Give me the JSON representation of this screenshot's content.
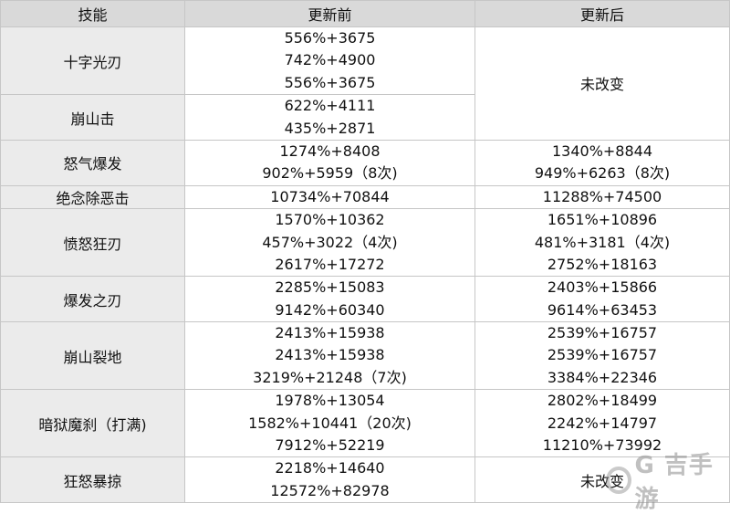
{
  "headers": {
    "skill": "技能",
    "before": "更新前",
    "after": "更新后"
  },
  "rows": [
    {
      "skill": "十字光刃",
      "before": [
        "556%+3675",
        "742%+4900",
        "556%+3675"
      ]
    },
    {
      "skill": "崩山击",
      "before": [
        "622%+4111",
        "435%+2871"
      ]
    },
    {
      "skill": "怒气爆发",
      "before": [
        "1274%+8408",
        "902%+5959（8次)"
      ],
      "after": [
        "1340%+8844",
        "949%+6263（8次)"
      ]
    },
    {
      "skill": "绝念除恶击",
      "before": [
        "10734%+70844"
      ],
      "after": [
        "11288%+74500"
      ]
    },
    {
      "skill": "愤怒狂刃",
      "before": [
        "1570%+10362",
        "457%+3022（4次)",
        "2617%+17272"
      ],
      "after": [
        "1651%+10896",
        "481%+3181（4次)",
        "2752%+18163"
      ]
    },
    {
      "skill": "爆发之刃",
      "before": [
        "2285%+15083",
        "9142%+60340"
      ],
      "after": [
        "2403%+15866",
        "9614%+63453"
      ]
    },
    {
      "skill": "崩山裂地",
      "before": [
        "2413%+15938",
        "2413%+15938",
        "3219%+21248（7次)"
      ],
      "after": [
        "2539%+16757",
        "2539%+16757",
        "3384%+22346"
      ]
    },
    {
      "skill": "暗狱魔刹（打满)",
      "before": [
        "1978%+13054",
        "1582%+10441（20次)",
        "7912%+52219"
      ],
      "after": [
        "2802%+18499",
        "2242%+14797",
        "11210%+73992"
      ]
    },
    {
      "skill": "狂怒暴掠",
      "before": [
        "2218%+14640",
        "12572%+82978"
      ]
    }
  ],
  "unchanged_label_1": "未改变",
  "unchanged_label_2": "未改变",
  "watermark": "G 吉手游"
}
